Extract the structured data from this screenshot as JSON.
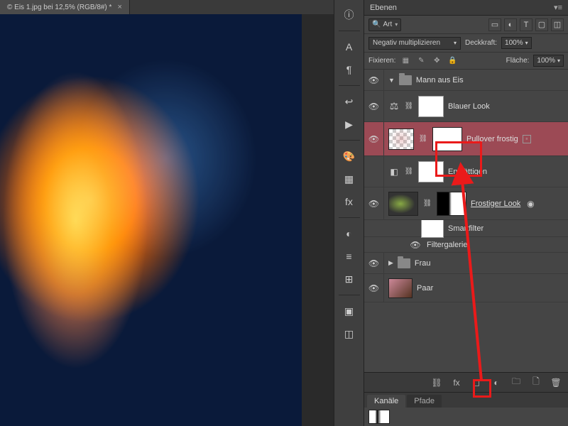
{
  "document": {
    "tab_title": "© Eis 1.jpg bei 12,5% (RGB/8#) *"
  },
  "panel": {
    "title": "Ebenen",
    "search_label": "Art",
    "blend_mode": "Negativ multiplizieren",
    "opacity_label": "Deckkraft:",
    "opacity_value": "100%",
    "lock_label": "Fixieren:",
    "fill_label": "Fläche:",
    "fill_value": "100%"
  },
  "layers": {
    "group1": "Mann aus Eis",
    "l_blauer": "Blauer Look",
    "l_pullover": "Pullover frostig",
    "l_entsatt": "Entsättigen",
    "l_frostig": "Frostiger Look",
    "smartfilter": "Smartfilter",
    "filtergalerie": "Filtergalerie",
    "group2": "Frau",
    "l_paar": "Paar"
  },
  "subpanel": {
    "tab_kanale": "Kanäle",
    "tab_pfade": "Pfade"
  }
}
